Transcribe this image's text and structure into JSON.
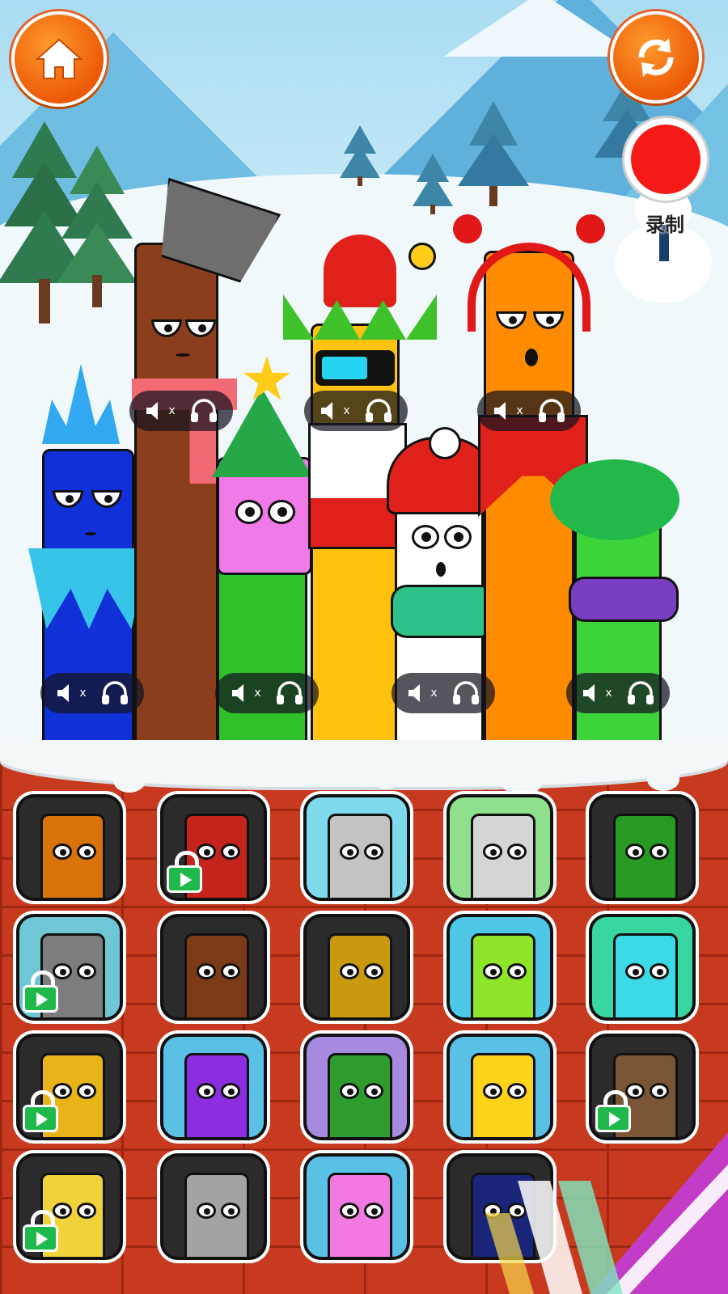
{
  "top_bar": {
    "home_button": "home-icon",
    "refresh_button": "refresh-icon",
    "record_label": "录制"
  },
  "stage_characters": [
    {
      "name": "blue-feather",
      "color": "#1030d8",
      "muted": true
    },
    {
      "name": "brown-bucket",
      "color": "#8a3e1c",
      "muted": true
    },
    {
      "name": "green-elf",
      "color": "#2ec12a",
      "muted": true
    },
    {
      "name": "yellow-jester",
      "color": "#ffc20e",
      "muted": true
    },
    {
      "name": "white-santa",
      "color": "#ffffff",
      "muted": true
    },
    {
      "name": "orange-headphones",
      "color": "#ff8c00",
      "muted": true
    },
    {
      "name": "green-flower",
      "color": "#3dd43a",
      "muted": true
    }
  ],
  "control_icons": {
    "mute": "speaker-mute-icon",
    "solo": "headphones-icon",
    "mute_mark": "x"
  },
  "character_grid": [
    {
      "name": "orange-headphones",
      "bg": "#2b2b2b",
      "color": "#d9730c",
      "locked": false
    },
    {
      "name": "red-christmas",
      "bg": "#2b2b2b",
      "color": "#c4241c",
      "locked": true
    },
    {
      "name": "gray-bow",
      "bg": "#7fd9ec",
      "color": "#c3c3c3",
      "locked": false
    },
    {
      "name": "robot",
      "bg": "#8fe08c",
      "color": "#d5d5d5",
      "locked": false
    },
    {
      "name": "green-flower",
      "bg": "#2b2b2b",
      "color": "#269a23",
      "locked": false
    },
    {
      "name": "gray-cat",
      "bg": "#6fc7d6",
      "color": "#7d7d7d",
      "locked": true
    },
    {
      "name": "brown-bucket",
      "bg": "#2b2b2b",
      "color": "#7a3b16",
      "locked": false
    },
    {
      "name": "yellow-jester",
      "bg": "#2b2b2b",
      "color": "#c99a10",
      "locked": false
    },
    {
      "name": "lime-spiky",
      "bg": "#4fc7e6",
      "color": "#8fe52a",
      "locked": false
    },
    {
      "name": "cyan-bear",
      "bg": "#38d6a0",
      "color": "#3cd9e6",
      "locked": false
    },
    {
      "name": "sun",
      "bg": "#2b2b2b",
      "color": "#e8b41a",
      "locked": true
    },
    {
      "name": "purple-cyclops",
      "bg": "#5ac0e6",
      "color": "#8a2ee0",
      "locked": false
    },
    {
      "name": "christmas-tree",
      "bg": "#a58ae0",
      "color": "#2e9b2e",
      "locked": false
    },
    {
      "name": "yellow-bowl-cut",
      "bg": "#5ac0e6",
      "color": "#ffd21a",
      "locked": false
    },
    {
      "name": "brown-hat",
      "bg": "#2b2b2b",
      "color": "#7a5636",
      "locked": true
    },
    {
      "name": "music-box",
      "bg": "#2b2b2b",
      "color": "#f0d23a",
      "locked": true
    },
    {
      "name": "gray-knight",
      "bg": "#2b2b2b",
      "color": "#a3a3a3",
      "locked": false
    },
    {
      "name": "pink-bunny",
      "bg": "#5ac0e6",
      "color": "#f07ae0",
      "locked": false
    },
    {
      "name": "navy-hidden",
      "bg": "#2b2b2b",
      "color": "#1a2478",
      "locked": false
    }
  ]
}
